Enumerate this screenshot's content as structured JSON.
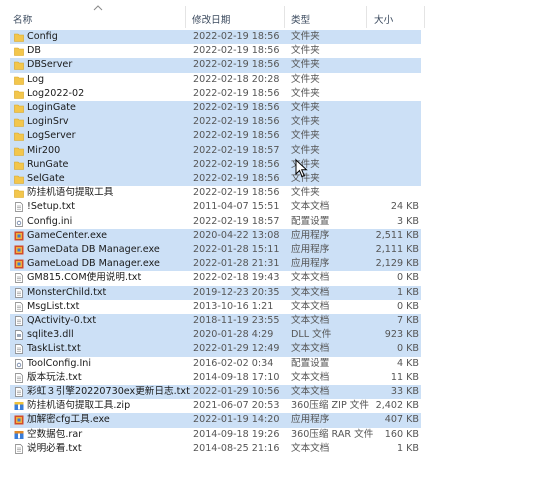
{
  "header": {
    "name": "名称",
    "date": "修改日期",
    "type": "类型",
    "size": "大小"
  },
  "files": [
    {
      "name": "Config",
      "date": "2022-02-19 18:56",
      "type": "文件夹",
      "size": "",
      "icon": "folder-icon",
      "selected": true
    },
    {
      "name": "DB",
      "date": "2022-02-19 18:56",
      "type": "文件夹",
      "size": "",
      "icon": "folder-icon",
      "selected": false
    },
    {
      "name": "DBServer",
      "date": "2022-02-19 18:56",
      "type": "文件夹",
      "size": "",
      "icon": "folder-icon",
      "selected": true
    },
    {
      "name": "Log",
      "date": "2022-02-18 20:28",
      "type": "文件夹",
      "size": "",
      "icon": "folder-icon",
      "selected": false
    },
    {
      "name": "Log2022-02",
      "date": "2022-02-19 18:56",
      "type": "文件夹",
      "size": "",
      "icon": "folder-icon",
      "selected": false
    },
    {
      "name": "LoginGate",
      "date": "2022-02-19 18:56",
      "type": "文件夹",
      "size": "",
      "icon": "folder-icon",
      "selected": true
    },
    {
      "name": "LoginSrv",
      "date": "2022-02-19 18:56",
      "type": "文件夹",
      "size": "",
      "icon": "folder-icon",
      "selected": true
    },
    {
      "name": "LogServer",
      "date": "2022-02-19 18:56",
      "type": "文件夹",
      "size": "",
      "icon": "folder-icon",
      "selected": true
    },
    {
      "name": "Mir200",
      "date": "2022-02-19 18:57",
      "type": "文件夹",
      "size": "",
      "icon": "folder-icon",
      "selected": true
    },
    {
      "name": "RunGate",
      "date": "2022-02-19 18:56",
      "type": "文件夹",
      "size": "",
      "icon": "folder-icon",
      "selected": true
    },
    {
      "name": "SelGate",
      "date": "2022-02-19 18:56",
      "type": "文件夹",
      "size": "",
      "icon": "folder-icon",
      "selected": true
    },
    {
      "name": "防挂机语句提取工具",
      "date": "2022-02-19 18:56",
      "type": "文件夹",
      "size": "",
      "icon": "folder-icon",
      "selected": false
    },
    {
      "name": "!Setup.txt",
      "date": "2011-04-07 15:51",
      "type": "文本文档",
      "size": "24 KB",
      "icon": "text-file-icon",
      "selected": false
    },
    {
      "name": "Config.ini",
      "date": "2022-02-19 18:57",
      "type": "配置设置",
      "size": "3 KB",
      "icon": "config-file-icon",
      "selected": false
    },
    {
      "name": "GameCenter.exe",
      "date": "2020-04-22 13:08",
      "type": "应用程序",
      "size": "2,511 KB",
      "icon": "exe-icon",
      "selected": true
    },
    {
      "name": "GameData DB Manager.exe",
      "date": "2022-01-28 15:11",
      "type": "应用程序",
      "size": "2,111 KB",
      "icon": "exe-icon",
      "selected": true
    },
    {
      "name": "GameLoad DB Manager.exe",
      "date": "2022-01-28 21:31",
      "type": "应用程序",
      "size": "2,129 KB",
      "icon": "exe-icon",
      "selected": true
    },
    {
      "name": "GM815.COM使用说明.txt",
      "date": "2022-02-18 19:43",
      "type": "文本文档",
      "size": "0 KB",
      "icon": "text-file-icon",
      "selected": false
    },
    {
      "name": "MonsterChild.txt",
      "date": "2019-12-23 20:35",
      "type": "文本文档",
      "size": "1 KB",
      "icon": "text-file-icon",
      "selected": true
    },
    {
      "name": "MsgList.txt",
      "date": "2013-10-16 1:21",
      "type": "文本文档",
      "size": "0 KB",
      "icon": "text-file-icon",
      "selected": false
    },
    {
      "name": "QActivity-0.txt",
      "date": "2018-11-19 23:55",
      "type": "文本文档",
      "size": "7 KB",
      "icon": "text-file-icon",
      "selected": true
    },
    {
      "name": "sqlite3.dll",
      "date": "2020-01-28 4:29",
      "type": "DLL 文件",
      "size": "923 KB",
      "icon": "dll-file-icon",
      "selected": true
    },
    {
      "name": "TaskList.txt",
      "date": "2022-01-29 12:49",
      "type": "文本文档",
      "size": "0 KB",
      "icon": "text-file-icon",
      "selected": true
    },
    {
      "name": "ToolConfig.Ini",
      "date": "2016-02-02 0:34",
      "type": "配置设置",
      "size": "4 KB",
      "icon": "config-file-icon",
      "selected": false
    },
    {
      "name": "版本玩法.txt",
      "date": "2014-09-18 17:10",
      "type": "文本文档",
      "size": "11 KB",
      "icon": "text-file-icon",
      "selected": false
    },
    {
      "name": "彩虹３引擎20220730ex更新日志.txt",
      "date": "2022-01-29 10:56",
      "type": "文本文档",
      "size": "33 KB",
      "icon": "text-file-icon",
      "selected": true
    },
    {
      "name": "防挂机语句提取工具.zip",
      "date": "2021-06-07 20:53",
      "type": "360压缩 ZIP 文件",
      "size": "2,402 KB",
      "icon": "zip-archive-icon",
      "selected": false
    },
    {
      "name": "加解密cfg工具.exe",
      "date": "2022-01-19 14:20",
      "type": "应用程序",
      "size": "407 KB",
      "icon": "exe-icon",
      "selected": true
    },
    {
      "name": "空数据包.rar",
      "date": "2014-09-18 19:26",
      "type": "360压缩 RAR 文件",
      "size": "160 KB",
      "icon": "rar-archive-icon",
      "selected": false
    },
    {
      "name": "说明必看.txt",
      "date": "2014-08-25 21:16",
      "type": "文本文档",
      "size": "1 KB",
      "icon": "text-file-icon",
      "selected": false
    }
  ],
  "colors": {
    "selection": "#cce0f6",
    "folder": "#f3c64c",
    "header_text": "#3b4a5e"
  }
}
